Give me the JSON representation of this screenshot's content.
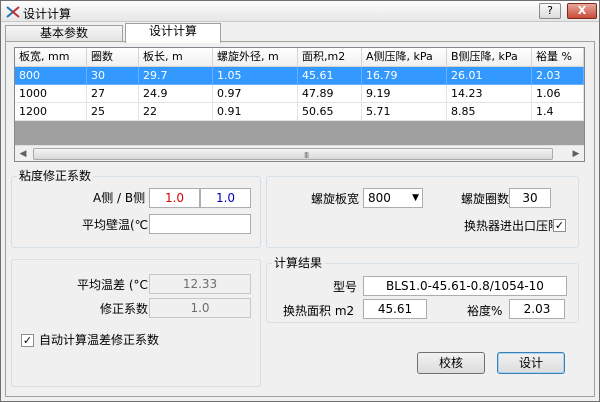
{
  "window": {
    "title": "设计计算",
    "help_label": "?",
    "close_label": "X"
  },
  "tabs": [
    {
      "label": "基本参数"
    },
    {
      "label": "设计计算"
    }
  ],
  "table": {
    "headers": [
      "板宽, mm",
      "圈数",
      "板长, m",
      "螺旋外径, m",
      "面积,m2",
      "A侧压降, kPa",
      "B侧压降, kPa",
      "裕量 %"
    ],
    "rows": [
      [
        "800",
        "30",
        "29.7",
        "1.05",
        "45.61",
        "16.79",
        "26.01",
        "2.03"
      ],
      [
        "1000",
        "27",
        "24.9",
        "0.97",
        "47.89",
        "9.19",
        "14.23",
        "1.06"
      ],
      [
        "1200",
        "25",
        "22",
        "0.91",
        "50.65",
        "5.71",
        "8.85",
        "1.4"
      ]
    ],
    "selected_row": 0,
    "scroll_left": "◀",
    "scroll_right": "▶",
    "scroll_grip": "III"
  },
  "viscosity": {
    "title": "粘度修正系数",
    "ab_label": "A侧 / B侧",
    "a_value": "1.0",
    "b_value": "1.0",
    "wall_temp_label": "平均壁温(℃)",
    "wall_temp_value": "",
    "a_color": "#e00000",
    "b_color": "#0000c0"
  },
  "spiral": {
    "plate_width_label": "螺旋板宽",
    "plate_width_value": "800",
    "turns_label": "螺旋圈数",
    "turns_value": "30",
    "pressure_drop_label": "换热器进出口压降",
    "pressure_drop_checked": "✓"
  },
  "temperature": {
    "avg_diff_label": "平均温差 (°C)",
    "avg_diff_value": "12.33",
    "correction_label": "修正系数",
    "correction_value": "1.0",
    "auto_label": "自动计算温差修正系数",
    "auto_checked": "✓"
  },
  "results": {
    "title": "计算结果",
    "model_label": "型号",
    "model_value": "BLS1.0-45.61-0.8/1054-10",
    "area_label": "换热面积 m2",
    "area_value": "45.61",
    "margin_label": "裕度%",
    "margin_value": "2.03"
  },
  "buttons": {
    "check": "校核",
    "design": "设计"
  },
  "colors": {
    "selection": "#3399ff"
  }
}
